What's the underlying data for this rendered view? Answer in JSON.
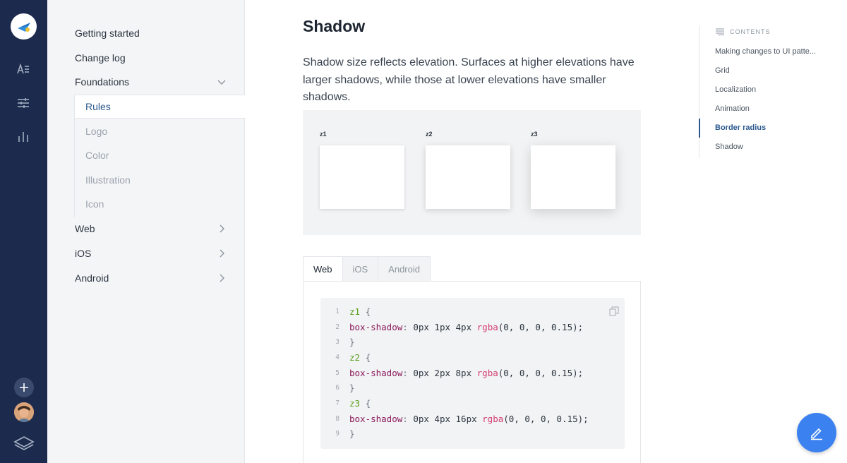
{
  "rail": {
    "icons": [
      "logo-icon",
      "docs-icon",
      "settings-sliders-icon",
      "chart-icon",
      "add-icon",
      "avatar",
      "layers-icon"
    ],
    "colors": {
      "background": "#1c2b4d",
      "logo_blue": "#1d73c4",
      "logo_yellow": "#f2c12e"
    }
  },
  "nav": {
    "items": [
      {
        "label": "Getting started"
      },
      {
        "label": "Change log"
      },
      {
        "label": "Foundations",
        "expanded": true
      },
      {
        "label": "Web",
        "expanded": false
      },
      {
        "label": "iOS",
        "expanded": false
      },
      {
        "label": "Android",
        "expanded": false
      }
    ],
    "foundations_sub": [
      {
        "label": "Rules",
        "active": true
      },
      {
        "label": "Logo"
      },
      {
        "label": "Color"
      },
      {
        "label": "Illustration"
      },
      {
        "label": "Icon"
      }
    ]
  },
  "main": {
    "title": "Shadow",
    "description": "Shadow size reflects elevation. Surfaces at higher elevations have larger shadows, while those at lower elevations have smaller shadows.",
    "examples": [
      {
        "label": "z1"
      },
      {
        "label": "z2"
      },
      {
        "label": "z3"
      }
    ],
    "tabs": [
      {
        "label": "Web",
        "active": true
      },
      {
        "label": "iOS"
      },
      {
        "label": "Android"
      }
    ],
    "code": {
      "lines": [
        {
          "n": "1",
          "selector": "z1",
          "open": " {"
        },
        {
          "n": "2",
          "prop": "box-shadow",
          "colon": ":",
          "values": " 0px 1px 4px ",
          "fn": "rgba",
          "args": "(0, 0, 0, 0.15);"
        },
        {
          "n": "3",
          "close": "}"
        },
        {
          "n": "4",
          "selector": "z2",
          "open": " {"
        },
        {
          "n": "5",
          "prop": "box-shadow",
          "colon": ":",
          "values": " 0px 2px 8px ",
          "fn": "rgba",
          "args": "(0, 0, 0, 0.15);"
        },
        {
          "n": "6",
          "close": "}"
        },
        {
          "n": "7",
          "selector": "z3",
          "open": " {"
        },
        {
          "n": "8",
          "prop": "box-shadow",
          "colon": ":",
          "values": " 0px 4px 16px ",
          "fn": "rgba",
          "args": "(0, 0, 0, 0.15);"
        },
        {
          "n": "9",
          "close": "}"
        }
      ]
    }
  },
  "toc": {
    "heading": "CONTENTS",
    "items": [
      {
        "label": "Making changes to UI patte..."
      },
      {
        "label": "Grid"
      },
      {
        "label": "Localization"
      },
      {
        "label": "Animation"
      },
      {
        "label": "Border radius",
        "active": true
      },
      {
        "label": "Shadow"
      }
    ]
  },
  "fab": {
    "icon": "edit-pencil-icon",
    "color": "#3b82f0"
  }
}
